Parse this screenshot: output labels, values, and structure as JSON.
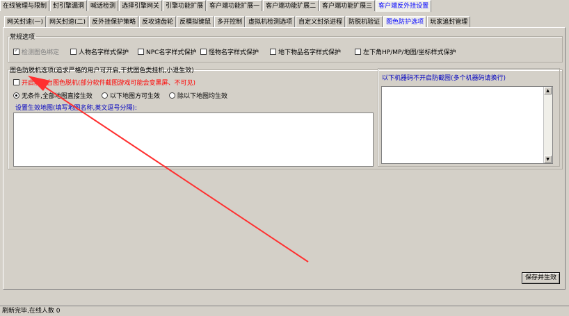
{
  "top_tabs": [
    "在线管理与限制",
    "封引擎漏洞",
    "喊话检测",
    "选择引擎网关",
    "引擎功能扩展",
    "客户端功能扩展一",
    "客户端功能扩展二",
    "客户端功能扩展三",
    "客户端反外挂设置"
  ],
  "sub_tabs": [
    "网关封速(一)",
    "网关封速(二)",
    "反外挂保护策略",
    "反攻速齿轮",
    "反模拟键鼠",
    "多开控制",
    "虚拟机检测选项",
    "自定义封杀进程",
    "防脱机验证",
    "图色防护选项",
    "玩家追封管理"
  ],
  "general": {
    "legend": "常规选项",
    "options": [
      "检测图色绑定",
      "人物名字样式保护",
      "NPC名字样式保护",
      "怪物名字样式保护",
      "地下物品名字样式保护",
      "左下角HP/MP/地图/坐标样式保护"
    ]
  },
  "anti_offline": {
    "legend": "图色防脱机选项(追求严格的用户可开启,干扰图色类挂机,小退生效)",
    "enable_label": "开启防前台图色脱机(部分软件截图游戏可能会变黑屏、不可见)",
    "radios": [
      "无条件,全部地图直接生效",
      "以下地图方可生效",
      "除以下地图均生效"
    ],
    "map_label": "设置生效地图(填写地图名称,英文逗号分隔):",
    "machine_label": "以下机器码不开启防截图(多个机器码请换行)"
  },
  "save_button": "保存并生效",
  "status_text": "刷新完毕,在线人数 0"
}
